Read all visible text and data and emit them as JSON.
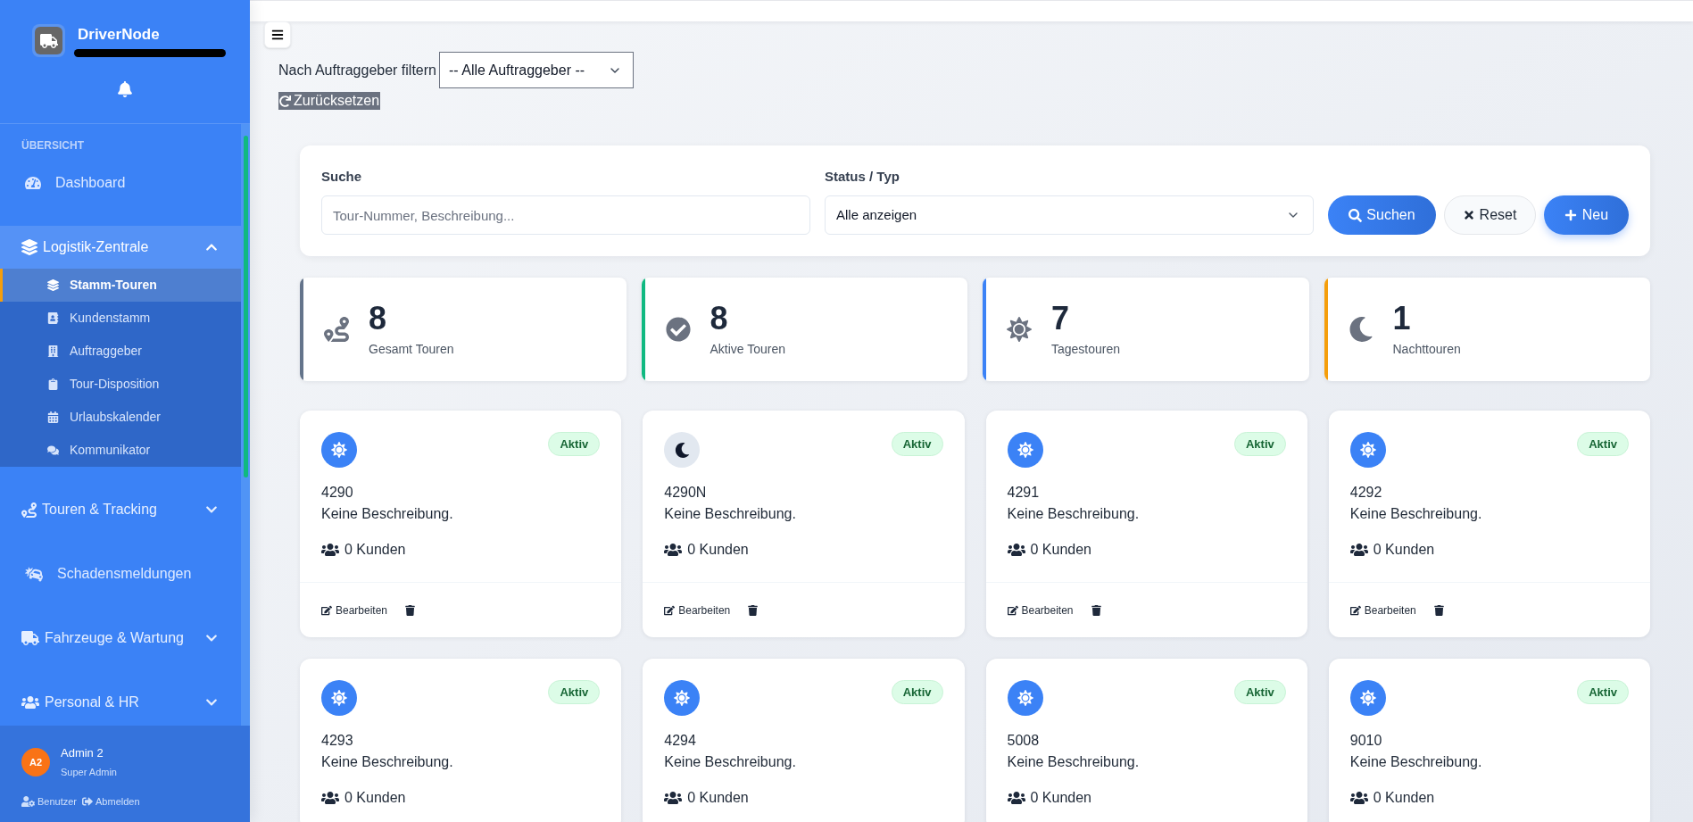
{
  "sidebar": {
    "brand": "DriverNode",
    "section_label": "ÜBERSICHT",
    "items": [
      {
        "kind": "link",
        "label": "Dashboard"
      },
      {
        "kind": "group",
        "label": "Logistik-Zentrale",
        "expanded": true,
        "children": [
          {
            "label": "Stamm-Touren",
            "selected": true
          },
          {
            "label": "Kundenstamm",
            "selected": false
          },
          {
            "label": "Auftraggeber",
            "selected": false
          },
          {
            "label": "Tour-Disposition",
            "selected": false
          },
          {
            "label": "Urlaubskalender",
            "selected": false
          },
          {
            "label": "Kommunikator",
            "selected": false
          }
        ]
      },
      {
        "kind": "group",
        "label": "Touren & Tracking",
        "expanded": false
      },
      {
        "kind": "link",
        "label": "Schadensmeldungen"
      },
      {
        "kind": "group",
        "label": "Fahrzeuge & Wartung",
        "expanded": false
      },
      {
        "kind": "group",
        "label": "Personal & HR",
        "expanded": false
      }
    ],
    "user": {
      "initials": "A2",
      "name": "Admin 2",
      "role": "Super Admin",
      "links": [
        "Benutzer",
        "Abmelden"
      ]
    }
  },
  "filter": {
    "label": "Nach Auftraggeber filtern",
    "value": "-- Alle Auftraggeber --",
    "reset": "Zurücksetzen"
  },
  "search_panel": {
    "search": {
      "label": "Suche",
      "placeholder": "Tour-Nummer, Beschreibung..."
    },
    "status": {
      "label": "Status / Typ",
      "value": "Alle anzeigen"
    },
    "buttons": [
      {
        "kind": "search",
        "label": "Suchen"
      },
      {
        "kind": "reset",
        "label": "Reset"
      },
      {
        "kind": "new",
        "label": "Neu"
      }
    ]
  },
  "stats": [
    {
      "value": "8",
      "label": "Gesamt Touren",
      "color": "#64748b"
    },
    {
      "value": "8",
      "label": "Aktive Touren",
      "color": "#10b981"
    },
    {
      "value": "7",
      "label": "Tagestouren",
      "color": "#3b82f6"
    },
    {
      "value": "1",
      "label": "Nachttouren",
      "color": "#f59e0b"
    }
  ],
  "tours": [
    {
      "kind": "day",
      "number": "4290",
      "status": "Aktiv",
      "description": "Keine Beschreibung.",
      "customers": "0 Kunden",
      "edit": "Bearbeiten"
    },
    {
      "kind": "night",
      "number": "4290N",
      "status": "Aktiv",
      "description": "Keine Beschreibung.",
      "customers": "0 Kunden",
      "edit": "Bearbeiten"
    },
    {
      "kind": "day",
      "number": "4291",
      "status": "Aktiv",
      "description": "Keine Beschreibung.",
      "customers": "0 Kunden",
      "edit": "Bearbeiten"
    },
    {
      "kind": "day",
      "number": "4292",
      "status": "Aktiv",
      "description": "Keine Beschreibung.",
      "customers": "0 Kunden",
      "edit": "Bearbeiten"
    },
    {
      "kind": "day",
      "number": "4293",
      "status": "Aktiv",
      "description": "Keine Beschreibung.",
      "customers": "0 Kunden"
    },
    {
      "kind": "day",
      "number": "4294",
      "status": "Aktiv",
      "description": "Keine Beschreibung.",
      "customers": "0 Kunden"
    },
    {
      "kind": "day",
      "number": "5008",
      "status": "Aktiv",
      "description": "Keine Beschreibung.",
      "customers": "0 Kunden"
    },
    {
      "kind": "day",
      "number": "9010",
      "status": "Aktiv",
      "description": "Keine Beschreibung.",
      "customers": "0 Kunden"
    }
  ]
}
